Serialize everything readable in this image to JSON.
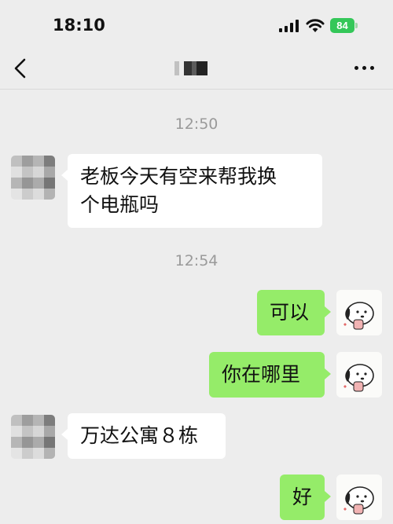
{
  "status_bar": {
    "time": "18:10",
    "battery": "84",
    "icons": [
      "cellular-signal-icon",
      "wifi-icon",
      "battery-icon"
    ],
    "battery_color": "#34c759"
  },
  "header": {
    "back_icon": "chevron-left-icon",
    "title": "",
    "more_icon": "more-horizontal-icon"
  },
  "colors": {
    "background": "#ededed",
    "incoming_bubble": "#ffffff",
    "outgoing_bubble": "#95ec69",
    "timestamp_text": "#9a9a9a"
  },
  "messages": [
    {
      "type": "timestamp",
      "text": "12:50"
    },
    {
      "type": "incoming",
      "text_lines": [
        "老板今天有空来帮我换",
        "个电瓶吗"
      ]
    },
    {
      "type": "timestamp",
      "text": "12:54"
    },
    {
      "type": "outgoing",
      "text": "可以"
    },
    {
      "type": "outgoing",
      "text": "你在哪里"
    },
    {
      "type": "incoming",
      "text": "万达公寓８栋"
    },
    {
      "type": "outgoing",
      "text": "好"
    }
  ]
}
